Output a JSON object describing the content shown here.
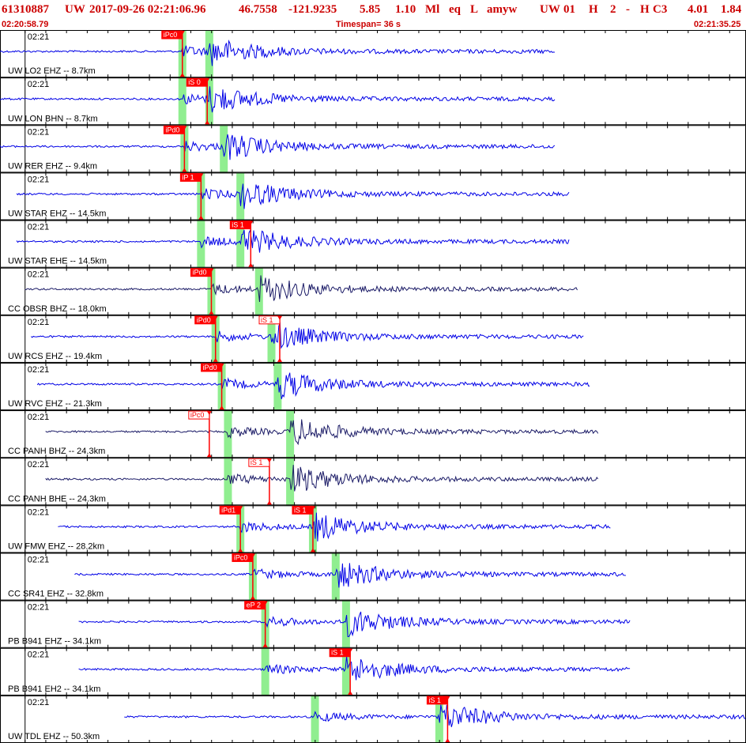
{
  "header": {
    "event_id": "61310887",
    "network": "UW",
    "origin_time": "2017-09-26 02:21:06.96",
    "latitude": "46.7558",
    "longitude": "-121.9235",
    "depth": "5.85",
    "magnitude": "1.10",
    "mag_type": "Ml",
    "event_type": "eq",
    "review_state": "L",
    "analyst": "amyw",
    "source": "UW",
    "version": "01",
    "quality_type": "H",
    "num_readings": "2",
    "dash": "-",
    "solution_flag": "H",
    "quality": "C3",
    "rms": "4.01",
    "gap": "1.84"
  },
  "timebar": {
    "start": "02:20:58.79",
    "timespan": "Timespan=  36 s",
    "end": "02:21:35.25"
  },
  "colors": {
    "header_text": "#cc0000",
    "trace_blue": "#0000e6",
    "trace_navy": "#1a1a66",
    "pick_red": "#ff0000",
    "pick_window": "#90ee90",
    "panel_border": "#000000"
  },
  "chart_data": {
    "type": "line",
    "title": "",
    "x_unit": "s",
    "xlim": [
      0,
      36
    ],
    "panels": [
      {
        "label": "UW LO2 EHZ -- 8.7km",
        "time": "02:21",
        "color": "blue",
        "trace_start": 0.0,
        "trace_end": 26.8,
        "p": 8.8,
        "s": 10.1,
        "picks": [
          {
            "text": "iPc0",
            "at": 8.8,
            "style": "solid"
          }
        ]
      },
      {
        "label": "UW LON BHN -- 8.7km",
        "time": "02:21",
        "color": "blue",
        "trace_start": 0.0,
        "trace_end": 26.8,
        "p": 8.8,
        "s": 10.1,
        "picks": [
          {
            "text": "iS 0",
            "at": 10.0,
            "style": "solid"
          }
        ]
      },
      {
        "label": "UW RER EHZ -- 9.4km",
        "time": "02:21",
        "color": "blue",
        "trace_start": 0.0,
        "trace_end": 26.8,
        "p": 8.9,
        "s": 10.8,
        "picks": [
          {
            "text": "iPd0",
            "at": 8.9,
            "style": "solid"
          }
        ]
      },
      {
        "label": "UW STAR EHZ -- 14.5km",
        "time": "02:21",
        "color": "blue",
        "trace_start": 0.8,
        "trace_end": 27.5,
        "p": 9.7,
        "s": 11.6,
        "picks": [
          {
            "text": "iP 1",
            "at": 9.7,
            "style": "solid"
          }
        ]
      },
      {
        "label": "UW STAR EHE -- 14.5km",
        "time": "02:21",
        "color": "blue",
        "trace_start": 0.8,
        "trace_end": 27.5,
        "p": 9.7,
        "s": 11.6,
        "picks": [
          {
            "text": "iS 1",
            "at": 12.1,
            "style": "solid"
          }
        ]
      },
      {
        "label": "CC OBSR BHZ -- 18.0km",
        "time": "02:21",
        "color": "navy",
        "trace_start": 1.2,
        "trace_end": 27.9,
        "p": 10.2,
        "s": 12.5,
        "picks": [
          {
            "text": "iPd0",
            "at": 10.2,
            "style": "solid"
          }
        ]
      },
      {
        "label": "UW RCS EHZ -- 19.4km",
        "time": "02:21",
        "color": "blue",
        "trace_start": 1.5,
        "trace_end": 28.2,
        "p": 10.4,
        "s": 13.1,
        "picks": [
          {
            "text": "iPd0",
            "at": 10.4,
            "style": "solid"
          },
          {
            "text": "iS 1",
            "at": 13.5,
            "style": "outline"
          }
        ]
      },
      {
        "label": "UW RVC EHZ -- 21.3km",
        "time": "02:21",
        "color": "blue",
        "trace_start": 1.8,
        "trace_end": 28.5,
        "p": 10.7,
        "s": 13.4,
        "picks": [
          {
            "text": "iPd0",
            "at": 10.7,
            "style": "solid"
          }
        ]
      },
      {
        "label": "CC PANH BHZ -- 24.3km",
        "time": "02:21",
        "color": "navy",
        "trace_start": 2.2,
        "trace_end": 28.9,
        "p": 11.0,
        "s": 14.0,
        "picks": [
          {
            "text": "iPc0",
            "at": 10.1,
            "style": "outline"
          }
        ]
      },
      {
        "label": "CC PANH BHE -- 24.3km",
        "time": "02:21",
        "color": "navy",
        "trace_start": 2.2,
        "trace_end": 28.9,
        "p": 11.0,
        "s": 14.0,
        "picks": [
          {
            "text": "iS 1",
            "at": 13.0,
            "style": "outline"
          }
        ]
      },
      {
        "label": "UW FMW EHZ -- 28.2km",
        "time": "02:21",
        "color": "blue",
        "trace_start": 2.8,
        "trace_end": 29.5,
        "p": 11.6,
        "s": 15.1,
        "picks": [
          {
            "text": "iPd1",
            "at": 11.6,
            "style": "solid"
          },
          {
            "text": "iS 1",
            "at": 15.1,
            "style": "solid"
          }
        ]
      },
      {
        "label": "CC SR41 EHZ -- 32.8km",
        "time": "02:21",
        "color": "blue",
        "trace_start": 3.6,
        "trace_end": 30.2,
        "p": 12.2,
        "s": 16.2,
        "picks": [
          {
            "text": "iPc0",
            "at": 12.2,
            "style": "solid"
          }
        ]
      },
      {
        "label": "PB B941 EHZ -- 34.1km",
        "time": "02:21",
        "color": "blue",
        "trace_start": 3.8,
        "trace_end": 30.4,
        "p": 12.8,
        "s": 16.7,
        "picks": [
          {
            "text": "eP 2",
            "at": 12.8,
            "style": "solid"
          }
        ]
      },
      {
        "label": "PB B941 EH2 -- 34.1km",
        "time": "02:21",
        "color": "blue",
        "trace_start": 3.8,
        "trace_end": 30.4,
        "p": 12.8,
        "s": 16.7,
        "picks": [
          {
            "text": "iS 1",
            "at": 16.9,
            "style": "solid"
          }
        ]
      },
      {
        "label": "UW TDL EHZ -- 50.3km",
        "time": "02:21",
        "color": "blue",
        "trace_start": 6.0,
        "trace_end": 36.0,
        "p": 15.2,
        "s": 21.2,
        "picks": [
          {
            "text": "iS 1",
            "at": 21.6,
            "style": "solid"
          }
        ]
      }
    ]
  }
}
